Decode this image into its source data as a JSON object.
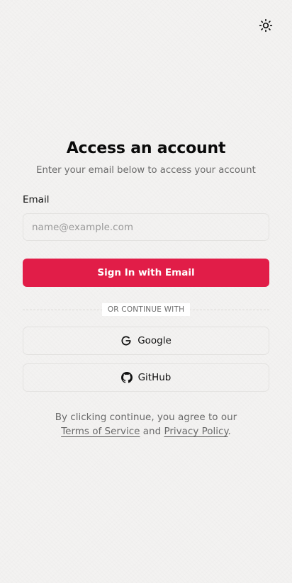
{
  "header": {
    "theme_toggle_icon": "sun-icon"
  },
  "auth": {
    "title": "Access an account",
    "subtitle": "Enter your email below to access your account",
    "email_label": "Email",
    "email_placeholder": "name@example.com",
    "email_value": "",
    "submit_label": "Sign In with Email",
    "divider_text": "OR CONTINUE WITH",
    "providers": [
      {
        "label": "Google",
        "icon": "google-icon"
      },
      {
        "label": "GitHub",
        "icon": "github-icon"
      }
    ],
    "terms": {
      "prefix": "By clicking continue, you agree to our",
      "tos_link": "Terms of Service",
      "and": "and",
      "privacy_link": "Privacy Policy",
      "suffix": "."
    }
  },
  "colors": {
    "primary": "#e11d48",
    "background": "#f3f2f1",
    "muted_text": "#6b6b6b",
    "border": "#e3e2e0"
  }
}
